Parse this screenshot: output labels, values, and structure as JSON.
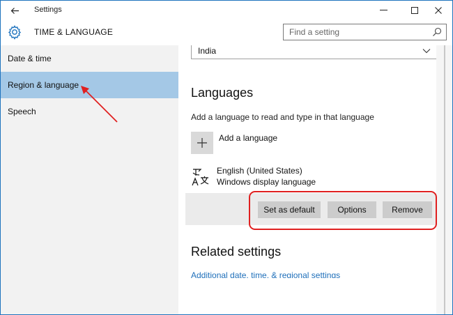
{
  "titlebar": {
    "app_title": "Settings",
    "back_icon": "back-arrow-icon",
    "minimize": "—",
    "maximize": "☐",
    "close": "✕"
  },
  "header": {
    "section_title": "TIME & LANGUAGE",
    "search_placeholder": "Find a setting",
    "icons": [
      "gear-icon",
      "search-icon"
    ]
  },
  "sidebar": {
    "items": [
      {
        "label": "Date & time",
        "selected": false
      },
      {
        "label": "Region & language",
        "selected": true
      },
      {
        "label": "Speech",
        "selected": false
      }
    ]
  },
  "region": {
    "country_value": "India"
  },
  "languages": {
    "heading": "Languages",
    "add_description": "Add a language to read and type in that language",
    "add_label": "Add a language",
    "add_icon": "plus-icon",
    "installed": [
      {
        "name": "English (United States)",
        "subtitle": "Windows display language",
        "icon": "language-icon"
      }
    ],
    "actions": {
      "set_default": "Set as default",
      "options": "Options",
      "remove": "Remove"
    }
  },
  "related": {
    "heading": "Related settings",
    "link": "Additional date, time, & regional settings"
  },
  "colors": {
    "accent": "#1e73be",
    "selected_nav": "#a4c8e6",
    "annotation": "#e02020",
    "link": "#1e6fba"
  }
}
